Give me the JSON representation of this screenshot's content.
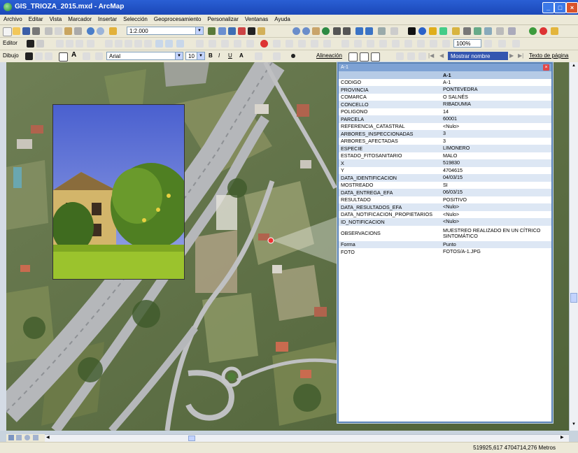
{
  "window": {
    "title": "GIS_TRIOZA_2015.mxd - ArcMap"
  },
  "menu": [
    "Archivo",
    "Editar",
    "Vista",
    "Marcador",
    "Insertar",
    "Selección",
    "Geoprocesamiento",
    "Personalizar",
    "Ventanas",
    "Ayuda"
  ],
  "toolbar": {
    "scale": "1:2.000",
    "editor": "Editor",
    "dibujo": "Dibujo",
    "font": "Arial",
    "font_size": "10",
    "bold": "B",
    "italic": "I",
    "underline": "U",
    "text_color": "A",
    "alineacion": "Alineación",
    "mostrar_nombre": "Mostrar nombre",
    "texto_pagina": "Texto de página",
    "zoom_pct": "100%"
  },
  "popup": {
    "title": "A-1",
    "header": "A-1",
    "rows": [
      {
        "key": "CODIGO",
        "value": "A-1"
      },
      {
        "key": "PROVINCIA",
        "value": "PONTEVEDRA"
      },
      {
        "key": "COMARCA",
        "value": "O SALNÉS"
      },
      {
        "key": "CONCELLO",
        "value": "RIBADUMIA"
      },
      {
        "key": "POLIGONO",
        "value": "14"
      },
      {
        "key": "PARCELA",
        "value": "60001"
      },
      {
        "key": "REFERENCIA_CATASTRAL",
        "value": "<Nulo>"
      },
      {
        "key": "ARBORES_INSPECCIONADAS",
        "value": "3"
      },
      {
        "key": "ARBORES_AFECTADAS",
        "value": "3"
      },
      {
        "key": "ESPECIE",
        "value": "LIMONERO"
      },
      {
        "key": "ESTADO_FITOSANITARIO",
        "value": "MALO"
      },
      {
        "key": "X",
        "value": "519830"
      },
      {
        "key": "Y",
        "value": "4704615"
      },
      {
        "key": "DATA_IDENTIFICACION",
        "value": "04/03/15"
      },
      {
        "key": "MOSTREADO",
        "value": "SI"
      },
      {
        "key": "DATA_ENTREGA_EFA",
        "value": "06/03/15"
      },
      {
        "key": "RESULTADO",
        "value": "POSITIVO"
      },
      {
        "key": "DATA_RESULTADOS_EFA",
        "value": "<Nulo>"
      },
      {
        "key": "DATA_NOTIFICACION_PROPIETARIOS",
        "value": "<Nulo>"
      },
      {
        "key": "ID_NOTIFICACION",
        "value": "<Nulo>"
      },
      {
        "key": "OBSERVACIONS",
        "value": "MUESTREO REALIZADO EN UN CÍTRICO SINTOMÁTICO"
      },
      {
        "key": "Forma",
        "value": "Punto"
      },
      {
        "key": "FOTO",
        "value": "FOTOS/A-1.JPG"
      }
    ]
  },
  "status": {
    "coordinates": "519925,617  4704714,276 Metros"
  }
}
